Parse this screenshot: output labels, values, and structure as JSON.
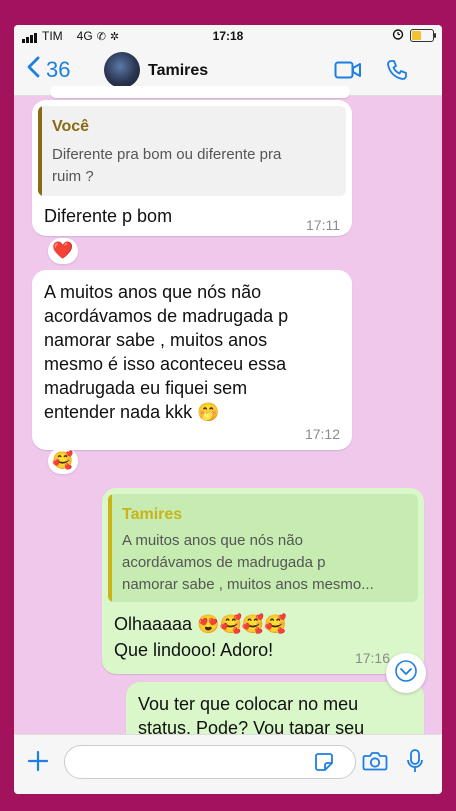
{
  "status": {
    "carrier": "TIM",
    "network": "4G",
    "time": "17:18"
  },
  "nav": {
    "back_count": "36",
    "contact_name": "Tamires"
  },
  "messages": {
    "m1": {
      "quote_author": "Você",
      "quote_text_line1": "Diferente pra bom ou diferente pra",
      "quote_text_line2": "ruim ?",
      "text": "Diferente p bom",
      "time": "17:11",
      "reaction": "❤️"
    },
    "m2": {
      "lines": [
        "A muitos anos que nós não",
        "acordávamos de madrugada p",
        "namorar sabe , muitos anos",
        "mesmo é isso aconteceu essa",
        "madrugada eu fiquei sem",
        "entender nada kkk 🤭"
      ],
      "time": "17:12",
      "reaction": "🥰"
    },
    "m3": {
      "quote_author": "Tamires",
      "quote_lines": [
        "A muitos anos que nós não",
        "acordávamos de madrugada p",
        "namorar sabe , muitos anos mesmo..."
      ],
      "line1": "Olhaaaaa 😍🥰🥰🥰",
      "line2": "Que lindooo! Adoro!",
      "time": "17:16"
    },
    "m4": {
      "line1": "Vou ter que colocar no meu",
      "line2": "status. Pode? Vou tapar seu"
    }
  },
  "input": {
    "placeholder": ""
  },
  "colors": {
    "accent": "#1d7fe0",
    "chat_bg": "#efc8ec",
    "frame": "#a3125c",
    "incoming": "#ffffff",
    "outgoing": "#d9f7c9",
    "quote_you": "#8a6a14",
    "quote_tamires": "#c9b318"
  }
}
